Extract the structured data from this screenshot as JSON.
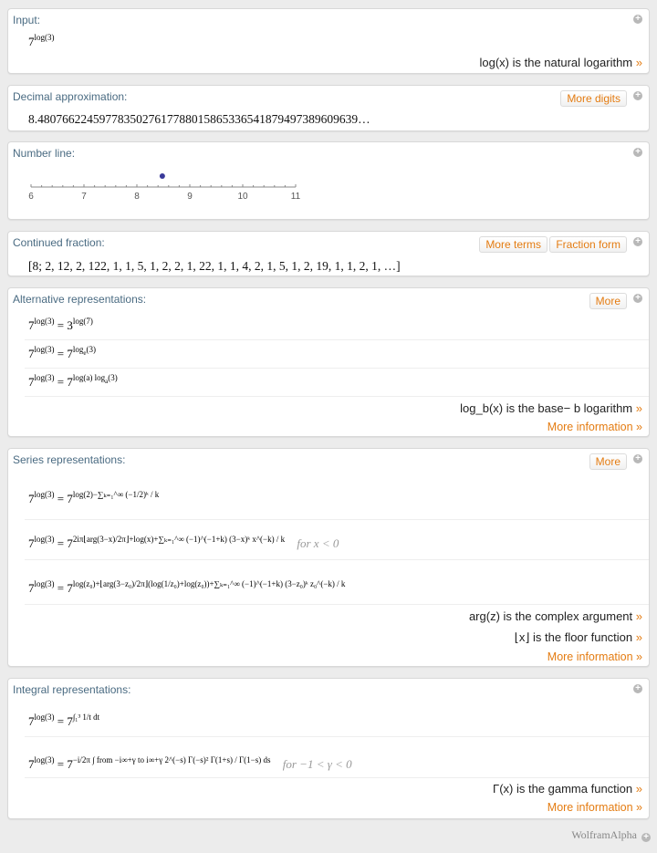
{
  "pods": {
    "input": {
      "title": "Input:",
      "base": "7",
      "exponent": "log(3)",
      "note": "log(x) is the natural logarithm",
      "note_arrow": "»"
    },
    "decimal": {
      "title": "Decimal approximation:",
      "button": "More digits",
      "value": "8.4807662245977835027617788015865336541879497389609639…"
    },
    "number_line": {
      "title": "Number line:",
      "ticks": [
        "6",
        "7",
        "8",
        "9",
        "10",
        "11"
      ],
      "min": 6,
      "max": 11,
      "point": 8.4808
    },
    "continued_fraction": {
      "title": "Continued fraction:",
      "buttons": [
        "More terms",
        "Fraction form"
      ],
      "value": "[8; 2, 12, 2, 122, 1, 1, 5, 1, 2, 2, 1, 22, 1, 1, 4, 2, 1, 5, 1, 2, 19, 1, 1, 2, 1, …]"
    },
    "alternative": {
      "title": "Alternative representations:",
      "button": "More",
      "lhs_base": "7",
      "lhs_exp": "log(3)",
      "rows": [
        {
          "base": "3",
          "exp": "log(7)"
        },
        {
          "base": "7",
          "exp": "log",
          "exp_sub": "e",
          "exp_tail": "(3)"
        },
        {
          "base": "7",
          "exp": "log(a) log",
          "exp_sub": "a",
          "exp_tail": "(3)"
        }
      ],
      "note": "log_b(x) is the base− b logarithm",
      "more_info": "More information »"
    },
    "series": {
      "title": "Series representations:",
      "button": "More",
      "row1_exp": "log(2)−∑ₖ₌₁^∞ (−1/2)ᵏ / k",
      "row2_exp": "2iπ⌊arg(3−x)/2π⌋+log(x)+∑ₖ₌₁^∞ (−1)^(−1+k) (3−x)ᵏ x^(−k) / k",
      "row2_cond": "for x < 0",
      "row3_exp": "log(z₀)+⌊arg(3−z₀)/2π⌋(log(1/z₀)+log(z₀))+∑ₖ₌₁^∞ (−1)^(−1+k) (3−z₀)ᵏ z₀^(−k) / k",
      "notes": [
        "arg(z) is the complex argument",
        "⌊x⌋ is the floor function"
      ],
      "more_info": "More information »"
    },
    "integral": {
      "title": "Integral representations:",
      "row1_exp": "∫₁³ 1/t dt",
      "row2_exp": "−i/2π ∫ from −i∞+γ to i∞+γ 2^(−s) Γ(−s)² Γ(1+s) / Γ(1−s) ds",
      "row2_cond": "for −1 < γ < 0",
      "note": "Γ(x) is the gamma function",
      "more_info": "More information »"
    }
  },
  "footer": {
    "brand": "WolframAlpha"
  },
  "colors": {
    "accent": "#e47c12",
    "title": "#4a6b82",
    "point": "#3a3a9a"
  }
}
